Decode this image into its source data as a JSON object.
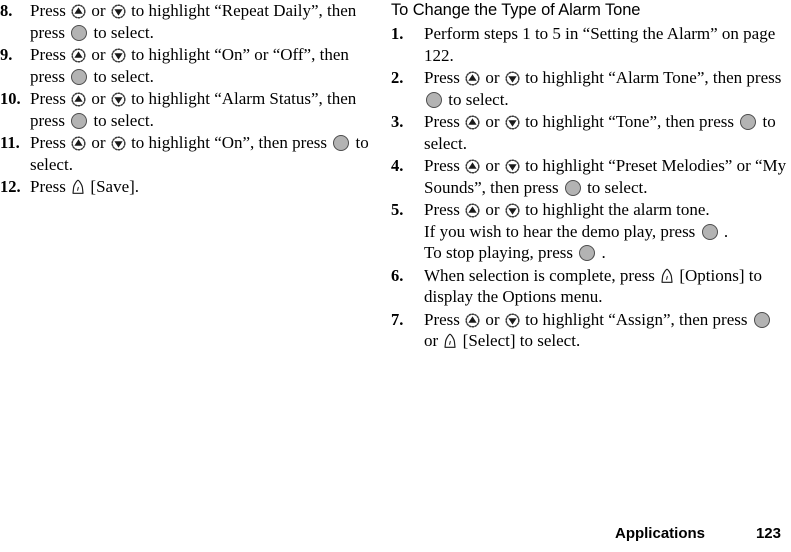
{
  "document": {
    "type": "mobile-phone-user-guide-page"
  },
  "left_column": {
    "steps": [
      {
        "number": "8.",
        "lines": [
          {
            "parts": [
              {
                "t": "text",
                "v": "Press "
              },
              {
                "t": "icon",
                "v": "nav-up-icon"
              },
              {
                "t": "text",
                "v": " or "
              },
              {
                "t": "icon",
                "v": "nav-down-icon"
              },
              {
                "t": "text",
                "v": " to highlight “Repeat Daily”, then press "
              },
              {
                "t": "icon",
                "v": "center-select-icon"
              },
              {
                "t": "text",
                "v": " to select."
              }
            ]
          }
        ]
      },
      {
        "number": "9.",
        "lines": [
          {
            "parts": [
              {
                "t": "text",
                "v": "Press "
              },
              {
                "t": "icon",
                "v": "nav-up-icon"
              },
              {
                "t": "text",
                "v": " or "
              },
              {
                "t": "icon",
                "v": "nav-down-icon"
              },
              {
                "t": "text",
                "v": " to highlight “On” or “Off”, then press "
              },
              {
                "t": "icon",
                "v": "center-select-icon"
              },
              {
                "t": "text",
                "v": " to select."
              }
            ]
          }
        ]
      },
      {
        "number": "10.",
        "lines": [
          {
            "parts": [
              {
                "t": "text",
                "v": "Press "
              },
              {
                "t": "icon",
                "v": "nav-up-icon"
              },
              {
                "t": "text",
                "v": " or "
              },
              {
                "t": "icon",
                "v": "nav-down-icon"
              },
              {
                "t": "text",
                "v": " to highlight “Alarm Status”, then press "
              },
              {
                "t": "icon",
                "v": "center-select-icon"
              },
              {
                "t": "text",
                "v": " to select."
              }
            ]
          }
        ]
      },
      {
        "number": "11.",
        "lines": [
          {
            "parts": [
              {
                "t": "text",
                "v": "Press "
              },
              {
                "t": "icon",
                "v": "nav-up-icon"
              },
              {
                "t": "text",
                "v": " or "
              },
              {
                "t": "icon",
                "v": "nav-down-icon"
              },
              {
                "t": "text",
                "v": " to highlight “On”, then press "
              },
              {
                "t": "icon",
                "v": "center-select-icon"
              },
              {
                "t": "text",
                "v": " to select."
              }
            ]
          }
        ]
      },
      {
        "number": "12.",
        "lines": [
          {
            "parts": [
              {
                "t": "text",
                "v": "Press "
              },
              {
                "t": "icon",
                "v": "soft-key-icon"
              },
              {
                "t": "text",
                "v": " [Save]."
              }
            ]
          }
        ]
      }
    ]
  },
  "right_column": {
    "heading": "To Change the Type of Alarm Tone",
    "steps": [
      {
        "number": "1.",
        "lines": [
          {
            "parts": [
              {
                "t": "text",
                "v": "Perform steps 1 to 5 in “Setting the Alarm” on page 122."
              }
            ]
          }
        ]
      },
      {
        "number": "2.",
        "lines": [
          {
            "parts": [
              {
                "t": "text",
                "v": "Press "
              },
              {
                "t": "icon",
                "v": "nav-up-icon"
              },
              {
                "t": "text",
                "v": " or "
              },
              {
                "t": "icon",
                "v": "nav-down-icon"
              },
              {
                "t": "text",
                "v": " to highlight “Alarm Tone”, then press "
              },
              {
                "t": "icon",
                "v": "center-select-icon"
              },
              {
                "t": "text",
                "v": " to select."
              }
            ]
          }
        ]
      },
      {
        "number": "3.",
        "lines": [
          {
            "parts": [
              {
                "t": "text",
                "v": "Press "
              },
              {
                "t": "icon",
                "v": "nav-up-icon"
              },
              {
                "t": "text",
                "v": " or "
              },
              {
                "t": "icon",
                "v": "nav-down-icon"
              },
              {
                "t": "text",
                "v": " to highlight “Tone”, then press "
              },
              {
                "t": "icon",
                "v": "center-select-icon"
              },
              {
                "t": "text",
                "v": " to select."
              }
            ]
          }
        ]
      },
      {
        "number": "4.",
        "lines": [
          {
            "parts": [
              {
                "t": "text",
                "v": "Press "
              },
              {
                "t": "icon",
                "v": "nav-up-icon"
              },
              {
                "t": "text",
                "v": " or "
              },
              {
                "t": "icon",
                "v": "nav-down-icon"
              },
              {
                "t": "text",
                "v": " to highlight “Preset Melodies” or “My Sounds”, then press "
              },
              {
                "t": "icon",
                "v": "center-select-icon"
              },
              {
                "t": "text",
                "v": " to select."
              }
            ]
          }
        ]
      },
      {
        "number": "5.",
        "lines": [
          {
            "parts": [
              {
                "t": "text",
                "v": "Press "
              },
              {
                "t": "icon",
                "v": "nav-up-icon"
              },
              {
                "t": "text",
                "v": " or "
              },
              {
                "t": "icon",
                "v": "nav-down-icon"
              },
              {
                "t": "text",
                "v": " to highlight the alarm tone."
              }
            ]
          },
          {
            "parts": [
              {
                "t": "text",
                "v": "If you wish to hear the demo play, press "
              },
              {
                "t": "icon",
                "v": "center-select-icon"
              },
              {
                "t": "text",
                "v": " ."
              }
            ]
          },
          {
            "parts": [
              {
                "t": "text",
                "v": "To stop playing, press "
              },
              {
                "t": "icon",
                "v": "center-select-icon"
              },
              {
                "t": "text",
                "v": " ."
              }
            ]
          }
        ]
      },
      {
        "number": "6.",
        "lines": [
          {
            "parts": [
              {
                "t": "text",
                "v": "When selection is complete, press "
              },
              {
                "t": "icon",
                "v": "soft-key-icon"
              },
              {
                "t": "text",
                "v": " [Options] to display the Options menu."
              }
            ]
          }
        ]
      },
      {
        "number": "7.",
        "lines": [
          {
            "parts": [
              {
                "t": "text",
                "v": "Press "
              },
              {
                "t": "icon",
                "v": "nav-up-icon"
              },
              {
                "t": "text",
                "v": " or "
              },
              {
                "t": "icon",
                "v": "nav-down-icon"
              },
              {
                "t": "text",
                "v": " to highlight “Assign”, then press "
              },
              {
                "t": "icon",
                "v": "center-select-icon"
              },
              {
                "t": "text",
                "v": " or "
              },
              {
                "t": "icon",
                "v": "soft-key-icon"
              },
              {
                "t": "text",
                "v": " [Select] to select."
              }
            ]
          }
        ]
      }
    ]
  },
  "footer": {
    "chapter": "Applications",
    "page_number": "123"
  },
  "colors": {
    "text": "#000000",
    "page_background": "#ffffff",
    "key_fill": "#b3b3b3",
    "key_stroke": "#4d4d4d"
  }
}
